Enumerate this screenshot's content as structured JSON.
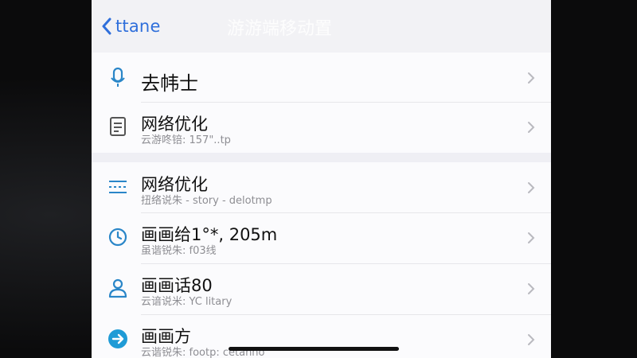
{
  "nav": {
    "back_label": "ttane",
    "title": "游游端移动置"
  },
  "group1": [
    {
      "icon": "microphone-icon",
      "title": "去帏士",
      "subtitle": ""
    },
    {
      "icon": "document-icon",
      "title": "网络优化",
      "subtitle": "云游咚锫: 157\"..tp"
    }
  ],
  "group2": [
    {
      "icon": "sliders-icon",
      "title": "网络优化",
      "subtitle": "扭络说朱 - story - delotmp"
    },
    {
      "icon": "clock-icon",
      "title": "画画给1°*, 205m",
      "subtitle": "虽谐锐朱: f03线"
    },
    {
      "icon": "person-icon",
      "title": "画画话80",
      "subtitle": "云谙说米: YC litary"
    },
    {
      "icon": "send-icon",
      "title": "画画方",
      "subtitle": "云谐锐朱: footp: cetanno"
    }
  ],
  "colors": {
    "accent": "#2f6fdb",
    "icon_teal": "#2a86c8"
  }
}
